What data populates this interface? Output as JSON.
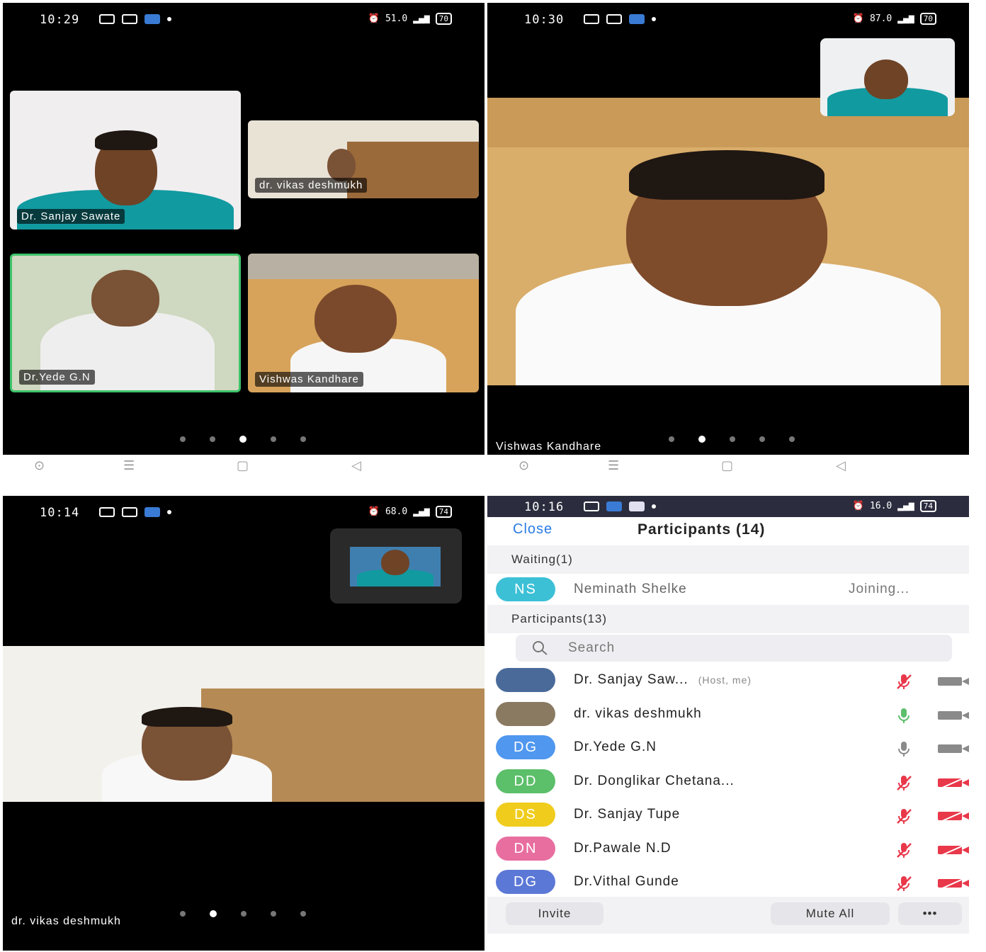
{
  "screens": [
    {
      "time": "10:29",
      "net_speed": "51.0",
      "battery": "70",
      "tiles": [
        {
          "name": "Dr. Sanjay Sawate"
        },
        {
          "name": "dr. vikas deshmukh"
        },
        {
          "name": "Dr.Yede G.N"
        },
        {
          "name": "Vishwas Kandhare"
        }
      ],
      "page_count": 5,
      "active_page": 3
    },
    {
      "time": "10:30",
      "net_speed": "87.0",
      "battery": "70",
      "speaker_name": "Vishwas Kandhare",
      "page_count": 5,
      "active_page": 2
    },
    {
      "time": "10:14",
      "net_speed": "68.0",
      "battery": "74",
      "speaker_name": "dr. vikas deshmukh",
      "page_count": 5,
      "active_page": 2
    },
    {
      "time": "10:16",
      "net_speed": "16.0",
      "battery": "74",
      "close_label": "Close",
      "title": "Participants (14)",
      "waiting_header": "Waiting(1)",
      "waiting": [
        {
          "initials": "NS",
          "name": "Neminath Shelke",
          "status": "Joining...",
          "color": "#3cc0d6"
        }
      ],
      "participants_header": "Participants(13)",
      "search_placeholder": "Search",
      "participants": [
        {
          "initials": "",
          "name": "Dr. Sanjay Saw...",
          "tag": "(Host, me)",
          "color": "#4a6a9a",
          "mic": "muted",
          "video": "on"
        },
        {
          "initials": "",
          "name": "dr. vikas deshmukh",
          "tag": "",
          "color": "#8a7a62",
          "mic": "active",
          "video": "on"
        },
        {
          "initials": "DG",
          "name": "Dr.Yede G.N",
          "tag": "",
          "color": "#4f97ef",
          "mic": "on",
          "video": "on"
        },
        {
          "initials": "DD",
          "name": "Dr. Donglikar Chetana...",
          "tag": "",
          "color": "#5cbf6a",
          "mic": "muted",
          "video": "off"
        },
        {
          "initials": "DS",
          "name": "Dr. Sanjay Tupe",
          "tag": "",
          "color": "#f0cc1c",
          "mic": "muted",
          "video": "off"
        },
        {
          "initials": "DN",
          "name": "Dr.Pawale N.D",
          "tag": "",
          "color": "#e86ea0",
          "mic": "muted",
          "video": "off"
        },
        {
          "initials": "DG",
          "name": "Dr.Vithal Gunde",
          "tag": "",
          "color": "#5b78d6",
          "mic": "muted",
          "video": "off"
        }
      ],
      "invite_label": "Invite",
      "mute_all_label": "Mute All",
      "more_label": "•••"
    }
  ],
  "nav_icons": [
    "home-circle-icon",
    "menu-lines-icon",
    "square-icon",
    "back-triangle-icon"
  ],
  "nav_glyphs": [
    "⊙",
    "☰",
    "▢",
    "◁"
  ],
  "colors": {
    "mic_muted": "#e8384a",
    "video_off": "#e8384a",
    "mic_active": "#5cbf6a",
    "neutral_icon": "#8a8a8a",
    "accent": "#2b7be4",
    "active_speaker_border": "#3fc36a"
  }
}
